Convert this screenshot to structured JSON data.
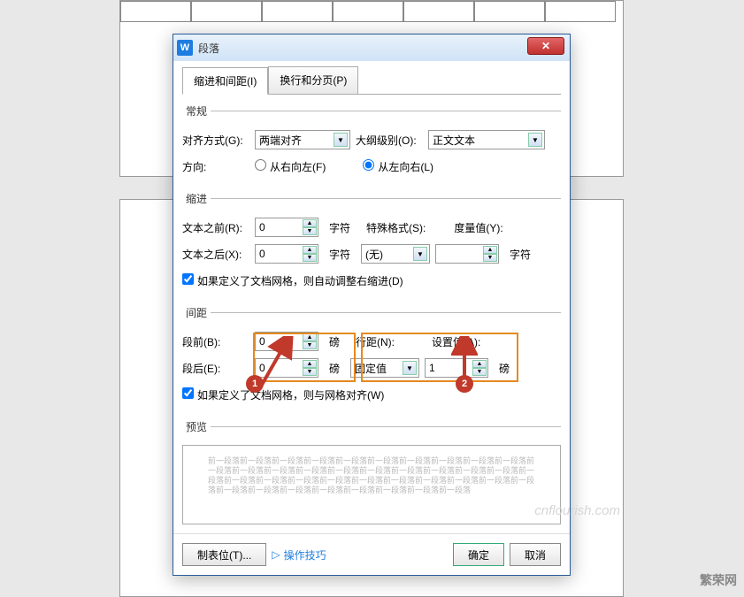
{
  "dialog": {
    "title": "段落",
    "tabs": {
      "indent": "缩进和间距(I)",
      "page": "换行和分页(P)"
    },
    "general": {
      "legend": "常规",
      "alignLabel": "对齐方式(G):",
      "alignValue": "两端对齐",
      "outlineLabel": "大纲级别(O):",
      "outlineValue": "正文文本",
      "directionLabel": "方向:",
      "rtl": "从右向左(F)",
      "ltr": "从左向右(L)"
    },
    "indent": {
      "legend": "缩进",
      "beforeLabel": "文本之前(R):",
      "beforeVal": "0",
      "unit1": "字符",
      "afterLabel": "文本之后(X):",
      "afterVal": "0",
      "unit2": "字符",
      "specialLabel": "特殊格式(S):",
      "specialVal": "(无)",
      "measureLabel": "度量值(Y):",
      "measureVal": "",
      "measureUnit": "字符",
      "check": "如果定义了文档网格，则自动调整右缩进(D)"
    },
    "spacing": {
      "legend": "间距",
      "beforeLabel": "段前(B):",
      "beforeVal": "0",
      "afterLabel": "段后(E):",
      "afterVal": "0",
      "unit": "磅",
      "lineLabel": "行距(N):",
      "lineVal": "固定值",
      "setLabel": "设置值(A):",
      "setVal": "1",
      "setUnit": "磅",
      "check": "如果定义了文档网格，则与网格对齐(W)"
    },
    "previewLabel": "预览",
    "previewText": "前一段落前一段落前一段落前一段落前一段落前一段落前一段落前一段落前一段落前一段落前一段落前一段落前一段落前一段落前一段落前一段落前一段落前一段落前一段落前一段落前一段落前一段落前一段落前一段落前一段落前一段落前一段落前一段落前一段落前一段落前一段落前一段落前一段落前一段落前一段落前一段落前一段落前一段落前一段落",
    "footer": {
      "tabstops": "制表位(T)...",
      "tips": "操作技巧",
      "ok": "确定",
      "cancel": "取消"
    }
  },
  "annotations": {
    "badge1": "1",
    "badge2": "2"
  },
  "watermark": "繁荣网",
  "watermark2": "cnflourish.com"
}
